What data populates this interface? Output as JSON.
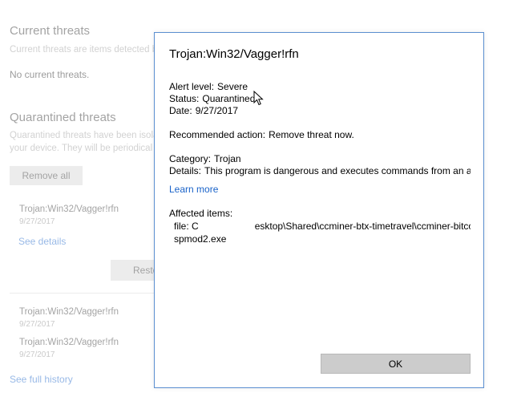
{
  "background": {
    "current_threats": {
      "heading": "Current threats",
      "description": "Current threats are items detected b",
      "status": "No current threats."
    },
    "quarantined_threats": {
      "heading": "Quarantined threats",
      "description_line1": "Quarantined threats have been isola",
      "description_line2": "your device.  They will be periodical",
      "remove_all_label": "Remove all",
      "item1_name": "Trojan:Win32/Vagger!rfn",
      "item1_date": "9/27/2017",
      "see_details_label": "See details",
      "restore_label": "Resto"
    },
    "history": {
      "item2_name": "Trojan:Win32/Vagger!rfn",
      "item2_date": "9/27/2017",
      "item3_name": "Trojan:Win32/Vagger!rfn",
      "item3_date": "9/27/2017",
      "see_full_history_label": "See full history"
    }
  },
  "dialog": {
    "title": "Trojan:Win32/Vagger!rfn",
    "alert_level_label": "Alert level:",
    "alert_level_value": "Severe",
    "status_label": "Status:",
    "status_value": "Quarantined",
    "date_label": "Date:",
    "date_value": "9/27/2017",
    "recommended_label": "Recommended action:",
    "recommended_value": "Remove threat now.",
    "category_label": "Category:",
    "category_value": "Trojan",
    "details_label": "Details:",
    "details_value": "This program is dangerous and executes commands from an attacker.",
    "learn_more_label": "Learn more",
    "affected_items_label": "Affected items:",
    "file_prefix": "file: C",
    "file_path_tail": "esktop\\Shared\\ccminer-btx-timetravel\\ccminer-bitcore",
    "file_line2": "spmod2.exe",
    "ok_label": "OK"
  },
  "colors": {
    "link": "#1a63c9",
    "dialog_border": "#5b8fd0",
    "button_gray": "#cccccc"
  }
}
